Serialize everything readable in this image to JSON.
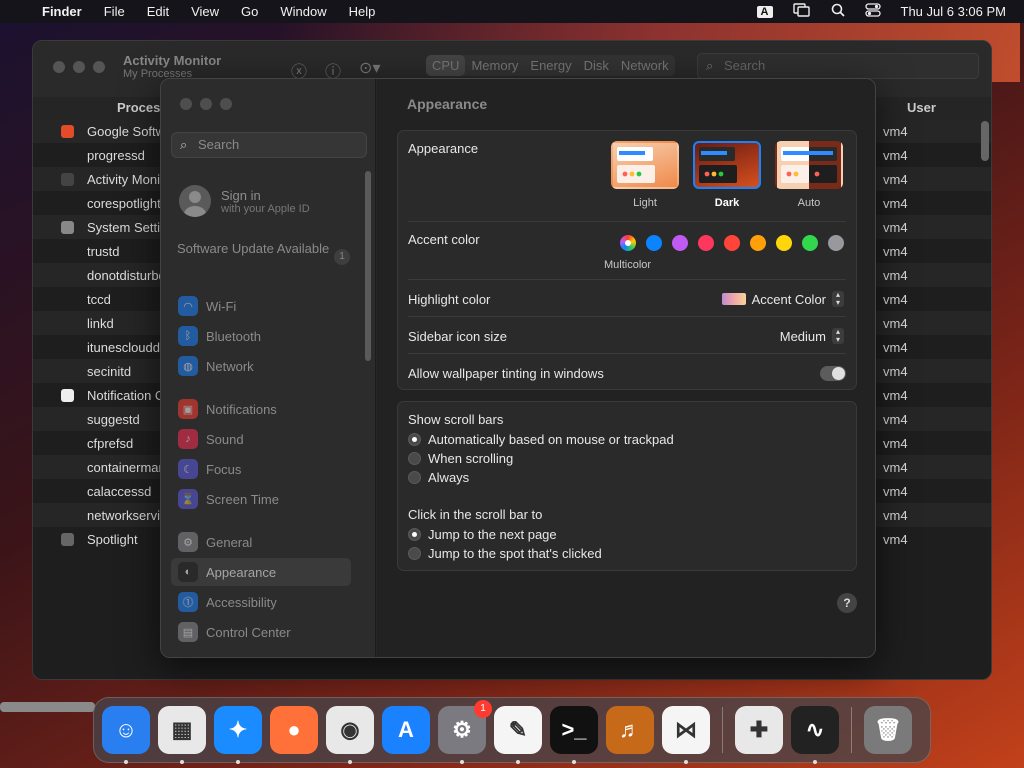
{
  "menubar": {
    "app": "Finder",
    "menus": [
      "File",
      "Edit",
      "View",
      "Go",
      "Window",
      "Help"
    ],
    "input_badge": "A",
    "clock": "Thu Jul 6  3:06 PM",
    "icons": [
      "apple-icon",
      "input-source-icon",
      "screen-mirroring-icon",
      "spotlight-icon",
      "control-center-icon"
    ]
  },
  "activity_monitor": {
    "title": "Activity Monitor",
    "subtitle": "My Processes",
    "tabs": [
      "CPU",
      "Memory",
      "Energy",
      "Disk",
      "Network"
    ],
    "selected_tab": "CPU",
    "search_placeholder": "Search",
    "columns": {
      "process": "Process Name",
      "user": "User"
    },
    "rows": [
      {
        "name": "Google Software Update",
        "user": "vm4",
        "icon_color": "#e34c26"
      },
      {
        "name": "progressd",
        "user": "vm4",
        "icon_color": ""
      },
      {
        "name": "Activity Monitor",
        "user": "vm4",
        "icon_color": "#444"
      },
      {
        "name": "corespotlightd",
        "user": "vm4",
        "icon_color": ""
      },
      {
        "name": "System Settings",
        "user": "vm4",
        "icon_color": "#888"
      },
      {
        "name": "trustd",
        "user": "vm4",
        "icon_color": ""
      },
      {
        "name": "donotdisturbd",
        "user": "vm4",
        "icon_color": ""
      },
      {
        "name": "tccd",
        "user": "vm4",
        "icon_color": ""
      },
      {
        "name": "linkd",
        "user": "vm4",
        "icon_color": ""
      },
      {
        "name": "itunescloudd",
        "user": "vm4",
        "icon_color": ""
      },
      {
        "name": "secinitd",
        "user": "vm4",
        "icon_color": ""
      },
      {
        "name": "Notification Center",
        "user": "vm4",
        "icon_color": "#eee"
      },
      {
        "name": "suggestd",
        "user": "vm4",
        "icon_color": ""
      },
      {
        "name": "cfprefsd",
        "user": "vm4",
        "icon_color": ""
      },
      {
        "name": "containermanagerd",
        "user": "vm4",
        "icon_color": ""
      },
      {
        "name": "calaccessd",
        "user": "vm4",
        "icon_color": ""
      },
      {
        "name": "networkserviceproxy",
        "user": "vm4",
        "icon_color": ""
      },
      {
        "name": "Spotlight",
        "user": "vm4",
        "icon_color": "#666"
      }
    ]
  },
  "settings": {
    "search_placeholder": "Search",
    "sign_in": {
      "line1": "Sign in",
      "line2": "with your Apple ID"
    },
    "software_update": {
      "label": "Software Update Available",
      "badge": "1"
    },
    "sidebar": [
      {
        "label": "Wi-Fi",
        "color": "#1a82ff",
        "glyph": "◠"
      },
      {
        "label": "Bluetooth",
        "color": "#1a82ff",
        "glyph": "ᛒ"
      },
      {
        "label": "Network",
        "color": "#1a82ff",
        "glyph": "◍"
      },
      {
        "label": "Notifications",
        "color": "#ff3b30",
        "glyph": "▣"
      },
      {
        "label": "Sound",
        "color": "#ff2d55",
        "glyph": "♪"
      },
      {
        "label": "Focus",
        "color": "#5e5ce6",
        "glyph": "☾"
      },
      {
        "label": "Screen Time",
        "color": "#5e5ce6",
        "glyph": "⌛"
      },
      {
        "label": "General",
        "color": "#8e8e93",
        "glyph": "⚙"
      },
      {
        "label": "Appearance",
        "color": "#1c1c1e",
        "glyph": "◐"
      },
      {
        "label": "Accessibility",
        "color": "#1a82ff",
        "glyph": "⓵"
      },
      {
        "label": "Control Center",
        "color": "#8e8e93",
        "glyph": "▤"
      }
    ],
    "selected": "Appearance",
    "page_title": "Appearance",
    "appearance_label": "Appearance",
    "themes": [
      "Light",
      "Dark",
      "Auto"
    ],
    "selected_theme": "Dark",
    "accent_label": "Accent color",
    "accent_colors": [
      "multicolor",
      "#0a84ff",
      "#bf5af2",
      "#ff375f",
      "#ff453a",
      "#ff9f0a",
      "#ffd60a",
      "#32d74b",
      "#98989d"
    ],
    "multicolor_label": "Multicolor",
    "highlight_label": "Highlight color",
    "highlight_value": "Accent Color",
    "sidebar_icon_label": "Sidebar icon size",
    "sidebar_icon_value": "Medium",
    "tinting_label": "Allow wallpaper tinting in windows",
    "tinting_on": true,
    "scroll_title": "Show scroll bars",
    "scroll_options": [
      "Automatically based on mouse or trackpad",
      "When scrolling",
      "Always"
    ],
    "scroll_selected": 0,
    "click_title": "Click in the scroll bar to",
    "click_options": [
      "Jump to the next page",
      "Jump to the spot that's clicked"
    ],
    "click_selected": 0,
    "help": "?"
  },
  "dock": {
    "items": [
      {
        "name": "finder",
        "color": "#2a7ff0",
        "glyph": "☺"
      },
      {
        "name": "launchpad",
        "color": "#e8e8e8",
        "glyph": "▦"
      },
      {
        "name": "safari",
        "color": "#1a8cff",
        "glyph": "✦"
      },
      {
        "name": "firefox",
        "color": "#ff7139",
        "glyph": "●"
      },
      {
        "name": "chrome",
        "color": "#e8e8e8",
        "glyph": "◉"
      },
      {
        "name": "app-store",
        "color": "#1a82ff",
        "glyph": "A"
      },
      {
        "name": "system-settings",
        "color": "#7a7a80",
        "glyph": "⚙",
        "badge": "1"
      },
      {
        "name": "textedit",
        "color": "#f5f5f5",
        "glyph": "✎"
      },
      {
        "name": "terminal",
        "color": "#111",
        "glyph": ">_"
      },
      {
        "name": "garageband",
        "color": "#c66a1a",
        "glyph": "♬"
      },
      {
        "name": "vscode",
        "color": "#f5f5f5",
        "glyph": "⋈"
      },
      {
        "name": "disk-utility",
        "color": "#e8e8e8",
        "glyph": "✚"
      },
      {
        "name": "activity-monitor",
        "color": "#222",
        "glyph": "∿"
      },
      {
        "name": "trash",
        "color": "#7a7a7a",
        "glyph": "🗑"
      }
    ]
  }
}
